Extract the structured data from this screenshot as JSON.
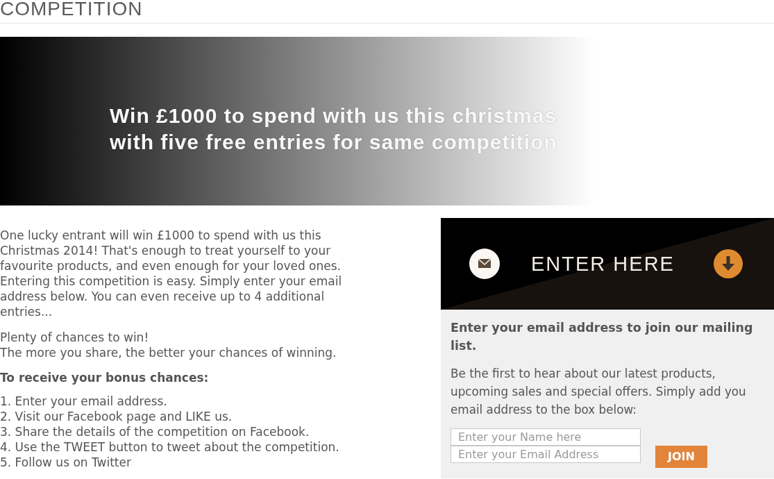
{
  "page_title": "COMPETITION",
  "banner": {
    "headline_lines": [
      "Win £1000 to spend with us this christmas",
      "with five free entries for same competition"
    ]
  },
  "intro": {
    "paragraph": "One lucky entrant will win £1000 to spend with us this Christmas 2014! That's enough to treat yourself to your favourite products, and even enough for your loved ones. Entering this competition is easy. Simply enter your email address below. You can even receive up to 4 additional entries...",
    "chances_lines": [
      "Plenty of chances to win!",
      "The more you share, the better your chances of winning."
    ],
    "bonus_heading": "To receive your bonus chances:",
    "steps": [
      "1. Enter your email address.",
      "2. Visit our Facebook page and LIKE us.",
      "3. Share the details of the competition on Facebook.",
      "4. Use the TWEET button to tweet about the competition.",
      "5. Follow us on Twitter"
    ]
  },
  "signup": {
    "header_label": "ENTER HERE",
    "heading": "Enter your email address to join our mailing list.",
    "description": "Be the first to hear about our latest products, upcoming sales and special offers. Simply add you email address to the box below:",
    "fields": [
      {
        "placeholder": "Enter your Name here"
      },
      {
        "placeholder": "Enter your Email Address"
      }
    ],
    "button": "JOIN"
  }
}
